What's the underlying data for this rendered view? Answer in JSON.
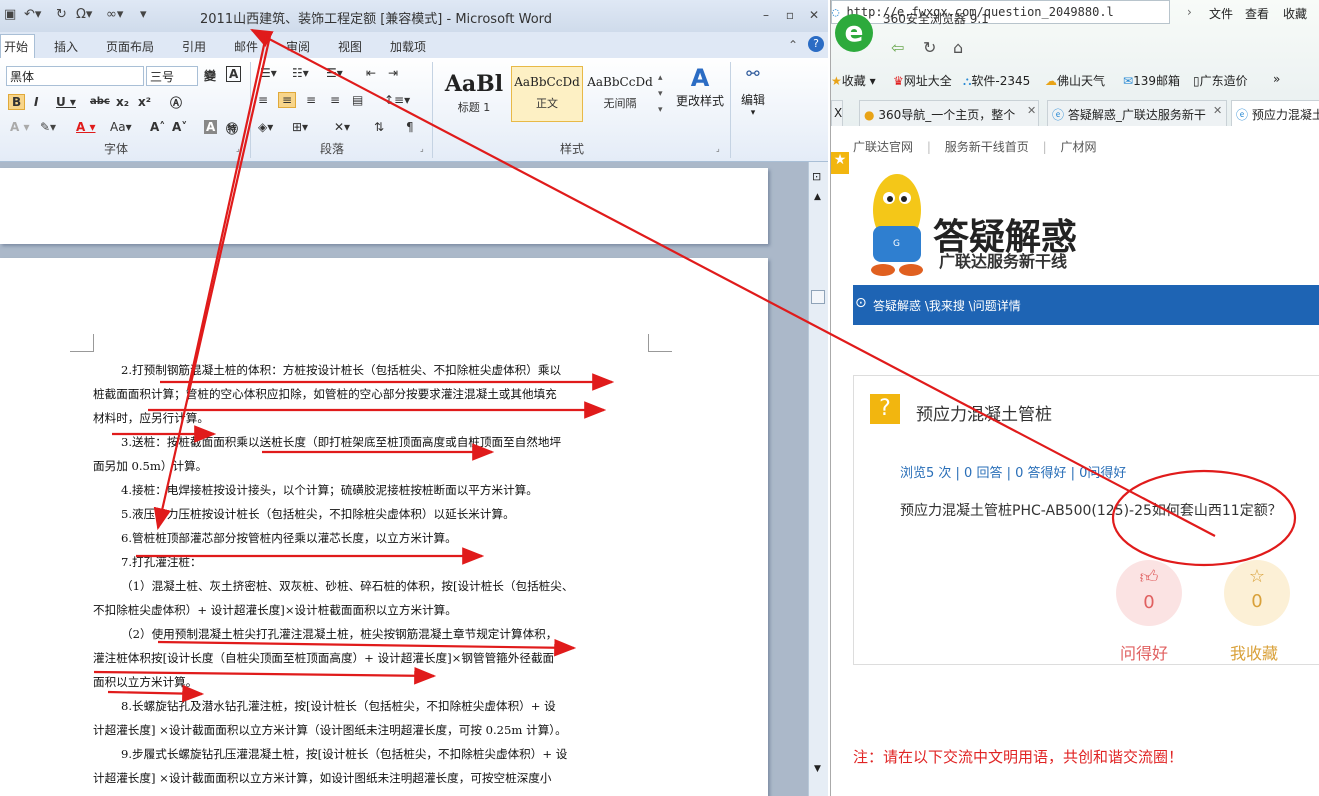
{
  "word": {
    "title": "2011山西建筑、装饰工程定额 [兼容模式] - Microsoft Word",
    "tabs": [
      "开始",
      "插入",
      "页面布局",
      "引用",
      "邮件",
      "审阅",
      "视图",
      "加载项"
    ],
    "font_name": "黑体",
    "font_size": "三号",
    "group_font": "字体",
    "group_paragraph": "段落",
    "group_styles": "样式",
    "styles": [
      {
        "preview": "AaBl",
        "name": "标题 1"
      },
      {
        "preview": "AaBbCcDd",
        "name": "正文"
      },
      {
        "preview": "AaBbCcDd",
        "name": "无间隔"
      }
    ],
    "change_styles": "更改样式",
    "edit": "编辑",
    "doc_lines": [
      {
        "text": "2.打预制钢筋混凝土桩的体积：方桩按设计桩长（包括桩尖、不扣除桩尖虚体积）乘以",
        "indent": true
      },
      {
        "text": "桩截面面积计算；管桩的空心体积应扣除，如管桩的空心部分按要求灌注混凝土或其他填充",
        "indent": false
      },
      {
        "text": "材料时，应另行计算。",
        "indent": false
      },
      {
        "text": "3.送桩：按桩截面面积乘以送桩长度（即打桩架底至桩顶面高度或自桩顶面至自然地坪",
        "indent": true
      },
      {
        "text": "面另加 0.5m）计算。",
        "indent": false
      },
      {
        "text": "4.接桩：电焊接桩按设计接头，以个计算；硫磺胶泥接桩按桩断面以平方米计算。",
        "indent": true
      },
      {
        "text": "5.液压静力压桩按设计桩长（包括桩尖，不扣除桩尖虚体积）以延长米计算。",
        "indent": true
      },
      {
        "text": "6.管桩桩顶部灌芯部分按管桩内径乘以灌芯长度，以立方米计算。",
        "indent": true
      },
      {
        "text": "7.打孔灌注桩：",
        "indent": true
      },
      {
        "text": "（1）混凝土桩、灰土挤密桩、双灰桩、砂桩、碎石桩的体积，按[设计桩长（包括桩尖、",
        "indent": true
      },
      {
        "text": "不扣除桩尖虚体积）+ 设计超灌长度]×设计桩截面面积以立方米计算。",
        "indent": false
      },
      {
        "text": "（2）使用预制混凝土桩尖打孔灌注混凝土桩，桩尖按钢筋混凝土章节规定计算体积，",
        "indent": true
      },
      {
        "text": "灌注桩体积按[设计长度（自桩尖顶面至桩顶面高度）+ 设计超灌长度]×钢管管箍外径截面",
        "indent": false
      },
      {
        "text": "面积以立方米计算。",
        "indent": false
      },
      {
        "text": "8.长螺旋钻孔及潜水钻孔灌注桩，按[设计桩长（包括桩尖，不扣除桩尖虚体积）+ 设",
        "indent": true
      },
      {
        "text": "计超灌长度] ×设计截面面积以立方米计算（设计图纸未注明超灌长度，可按 0.25m 计算）。",
        "indent": false
      },
      {
        "text": "9.步履式长螺旋钻孔压灌混凝土桩，按[设计桩长（包括桩尖，不扣除桩尖虚体积）+ 设",
        "indent": true
      },
      {
        "text": "计超灌长度] ×设计截面面积以立方米计算，如设计图纸未注明超灌长度，可按空桩深度小",
        "indent": false
      }
    ]
  },
  "browser": {
    "title": "360安全浏览器 9.1",
    "menu": [
      "文件",
      "查看",
      "收藏"
    ],
    "url": "http://e.fwxgx.com/question_2049880.l",
    "bookmarks": [
      "收藏",
      "网址大全",
      "软件-2345",
      "佛山天气",
      "139邮箱",
      "广东造价"
    ],
    "tabs": [
      "360导航_一个主页，整个",
      "答疑解惑_广联达服务新干",
      "预应力混凝土"
    ],
    "site_nav": [
      "广联达官网",
      "服务新干线首页",
      "广材网"
    ],
    "banner_title": "答疑解惑",
    "banner_sub": "广联达服务新干线",
    "breadcrumb": "答疑解惑 \\我来搜 \\问题详情",
    "question_title": "预应力混凝土管桩",
    "stats": "浏览5 次 | 0 回答 | 0 答得好 | 0问得好",
    "question_body": "预应力混凝土管桩PHC-AB500(125)-25如何套山西11定额？",
    "good_count": "0",
    "good_label": "问得好",
    "fav_count": "0",
    "fav_label": "我收藏",
    "notice": "注：请在以下交流中文明用语，共创和谐交流圈！"
  },
  "colors": {
    "annotation": "#e01b1b",
    "word_blue": "#2b579a",
    "browser_blue": "#1e64b4",
    "good_pink": "#e06060",
    "fav_gold": "#d9a13a"
  }
}
